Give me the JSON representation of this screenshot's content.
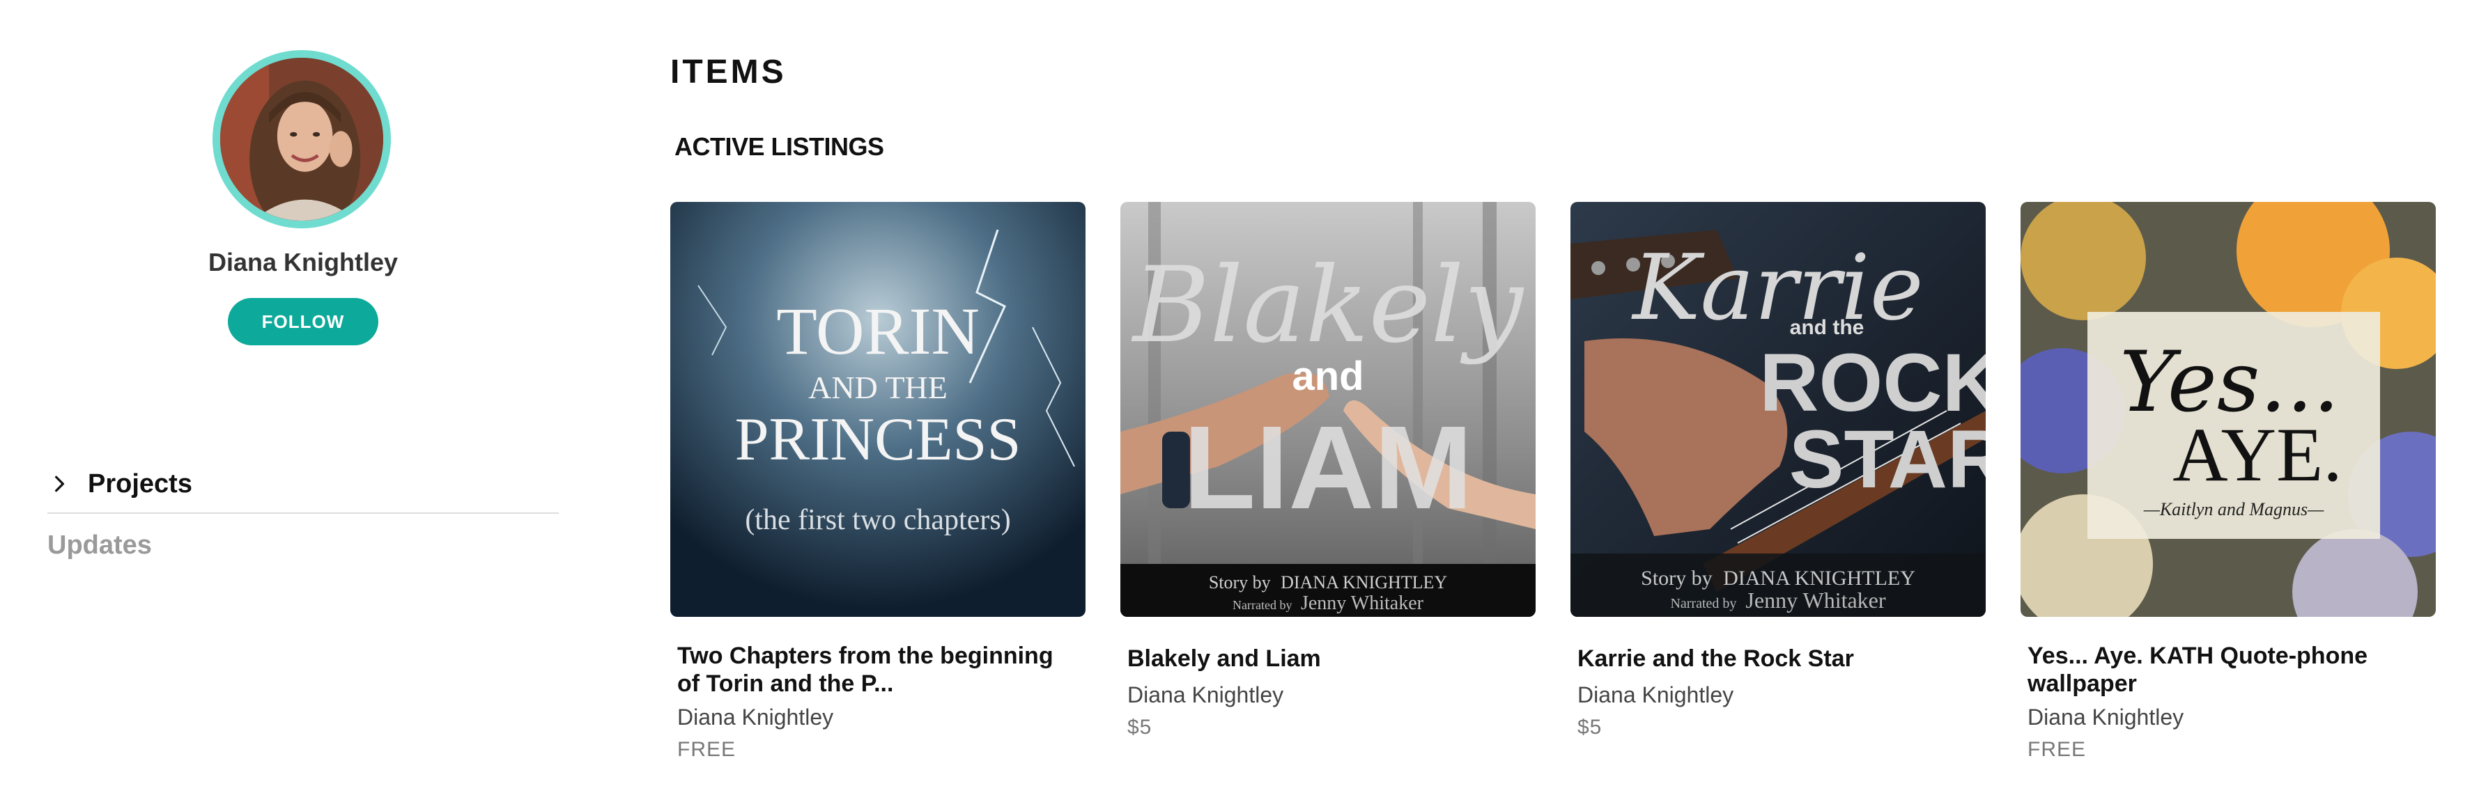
{
  "creator": {
    "name": "Diana Knightley",
    "follow_label": "FOLLOW"
  },
  "sidebar": {
    "nav": [
      {
        "label": "Projects"
      },
      {
        "label": "Updates"
      }
    ]
  },
  "main": {
    "title": "ITEMS",
    "section_title": "ACTIVE LISTINGS",
    "listings": [
      {
        "title": "Two Chapters from the beginning of Torin and the P...",
        "author": "Diana Knightley",
        "price": "FREE",
        "cover": {
          "line1": "TORIN",
          "line2": "AND THE",
          "line3": "PRINCESS",
          "line4": "(the first two chapters)"
        }
      },
      {
        "title": "Blakely and Liam",
        "author": "Diana Knightley",
        "price": "$5",
        "cover": {
          "line1": "Blakely",
          "line2": "and",
          "line3": "LIAM",
          "story_prefix": "Story by",
          "story_name": "DIANA KNIGHTLEY",
          "narr_prefix": "Narrated by",
          "narr_name": "Jenny Whitaker"
        }
      },
      {
        "title": "Karrie and the Rock Star",
        "author": "Diana Knightley",
        "price": "$5",
        "cover": {
          "line1": "Karrie",
          "line2": "and the",
          "line3": "ROCK",
          "line4": "STAR",
          "story_prefix": "Story by",
          "story_name": "DIANA KNIGHTLEY",
          "narr_prefix": "Narrated by",
          "narr_name": "Jenny Whitaker"
        }
      },
      {
        "title": "Yes... Aye. KATH Quote-phone wallpaper",
        "author": "Diana Knightley",
        "price": "FREE",
        "cover": {
          "line1": "Yes...",
          "line2": "AYE.",
          "line3": "—Kaitlyn and Magnus—"
        }
      }
    ]
  },
  "colors": {
    "accent": "#0da99a",
    "avatar_ring": "#6fdccf",
    "muted_nav": "#9a9a9a"
  },
  "icons": {
    "projects_chevron": "chevron-right-icon"
  }
}
